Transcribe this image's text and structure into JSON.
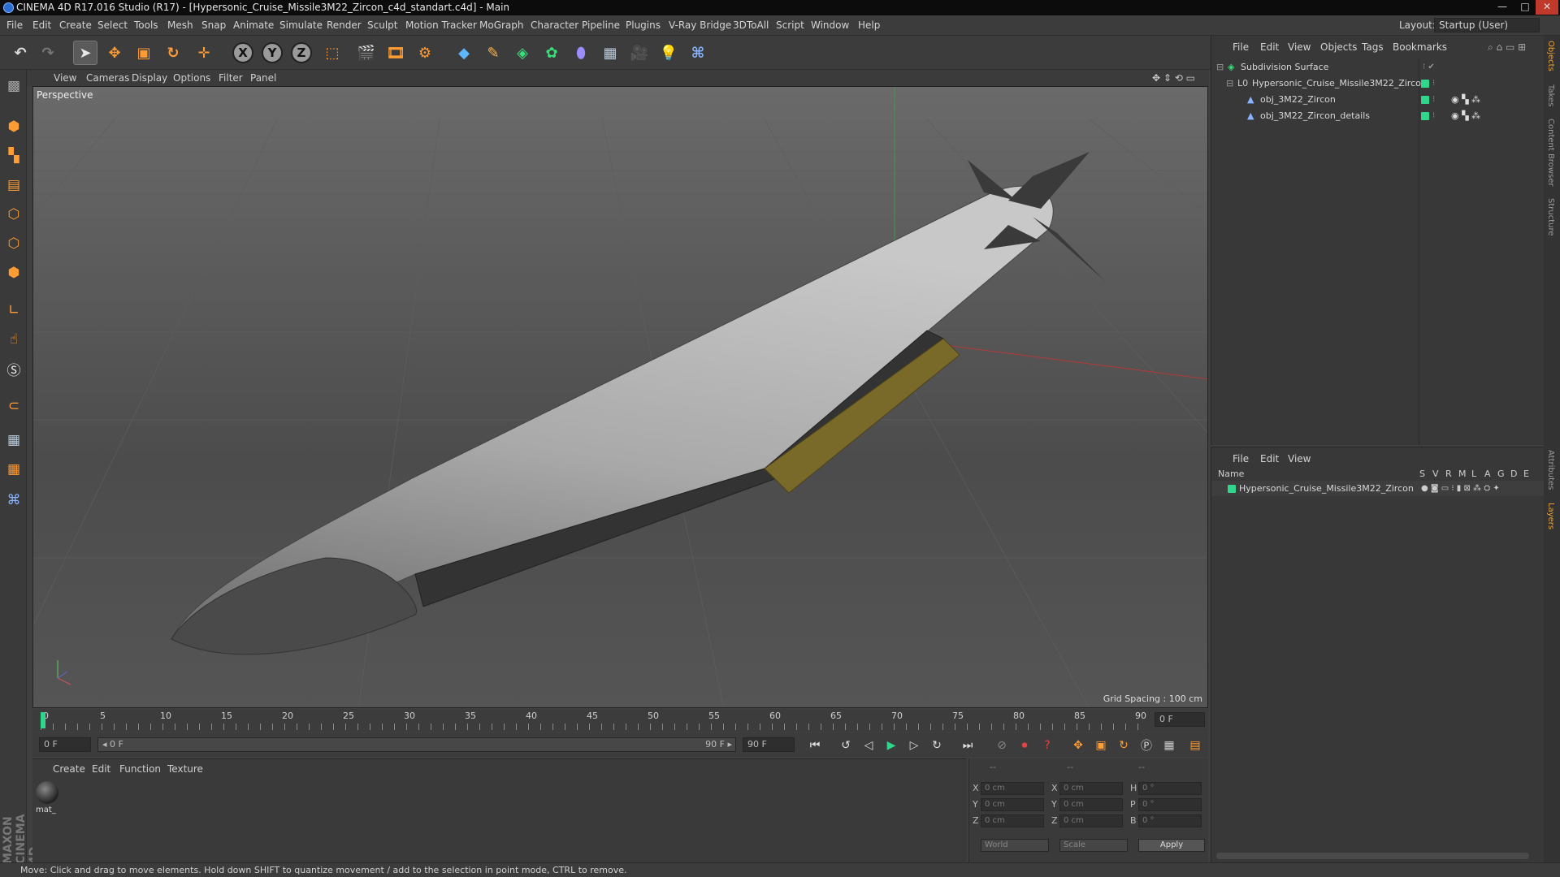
{
  "window": {
    "title": "CINEMA 4D R17.016 Studio (R17) - [Hypersonic_Cruise_Missile3M22_Zircon_c4d_standart.c4d] - Main",
    "buttons": [
      "—",
      "□",
      "✕"
    ]
  },
  "menubar": {
    "items": [
      "File",
      "Edit",
      "Create",
      "Select",
      "Tools",
      "Mesh",
      "Snap",
      "Animate",
      "Simulate",
      "Render",
      "Sculpt",
      "Motion Tracker",
      "MoGraph",
      "Character",
      "Pipeline",
      "Plugins",
      "V-Ray Bridge",
      "3DToAll",
      "Script",
      "Window",
      "Help"
    ],
    "layout_label": "Layout:",
    "layout_value": "Startup (User)"
  },
  "toolbar": {
    "axes": [
      "X",
      "Y",
      "Z"
    ]
  },
  "viewport": {
    "menu": [
      "View",
      "Cameras",
      "Display",
      "Options",
      "Filter",
      "Panel"
    ],
    "label": "Perspective",
    "grid_spacing": "Grid Spacing : 100 cm"
  },
  "timeline": {
    "ticks": [
      "0",
      "5",
      "10",
      "15",
      "20",
      "25",
      "30",
      "35",
      "40",
      "45",
      "50",
      "55",
      "60",
      "65",
      "70",
      "75",
      "80",
      "85",
      "90"
    ],
    "current_frame": "0 F",
    "start_field": "0 F",
    "range_start": "◂ 0 F",
    "range_end": "90 F ▸",
    "end_field": "90 F"
  },
  "material_manager": {
    "menu": [
      "Create",
      "Edit",
      "Function",
      "Texture"
    ],
    "materials": [
      {
        "name": "mat_"
      }
    ]
  },
  "coordinates": {
    "header": [
      "--",
      "--",
      "--"
    ],
    "rows": [
      {
        "l1": "X",
        "v1": "0 cm",
        "l2": "X",
        "v2": "0 cm",
        "l3": "H",
        "v3": "0 °"
      },
      {
        "l1": "Y",
        "v1": "0 cm",
        "l2": "Y",
        "v2": "0 cm",
        "l3": "P",
        "v3": "0 °"
      },
      {
        "l1": "Z",
        "v1": "0 cm",
        "l2": "Z",
        "v2": "0 cm",
        "l3": "B",
        "v3": "0 °"
      }
    ],
    "world": "World",
    "scale": "Scale",
    "apply": "Apply"
  },
  "object_manager": {
    "menu": [
      "File",
      "Edit",
      "View",
      "Objects",
      "Tags",
      "Bookmarks"
    ],
    "objects": [
      {
        "name": "Subdivision Surface"
      },
      {
        "name": "Hypersonic_Cruise_Missile3M22_Zircon"
      },
      {
        "name": "obj_3M22_Zircon"
      },
      {
        "name": "obj_3M22_Zircon_details"
      }
    ]
  },
  "layer_manager": {
    "menu": [
      "File",
      "Edit",
      "View"
    ],
    "columns": [
      "Name",
      "S",
      "V",
      "R",
      "M",
      "L",
      "A",
      "G",
      "D",
      "E"
    ],
    "layers": [
      {
        "name": "Hypersonic_Cruise_Missile3M22_Zircon",
        "color": "#2fd68c"
      }
    ]
  },
  "side_tabs": [
    "Objects",
    "Takes",
    "Content Browser",
    "Structure",
    "Attributes",
    "Layers"
  ],
  "status": "Move: Click and drag to move elements. Hold down SHIFT to quantize movement / add to the selection in point mode, CTRL to remove.",
  "brand": "MAXON CINEMA 4D"
}
